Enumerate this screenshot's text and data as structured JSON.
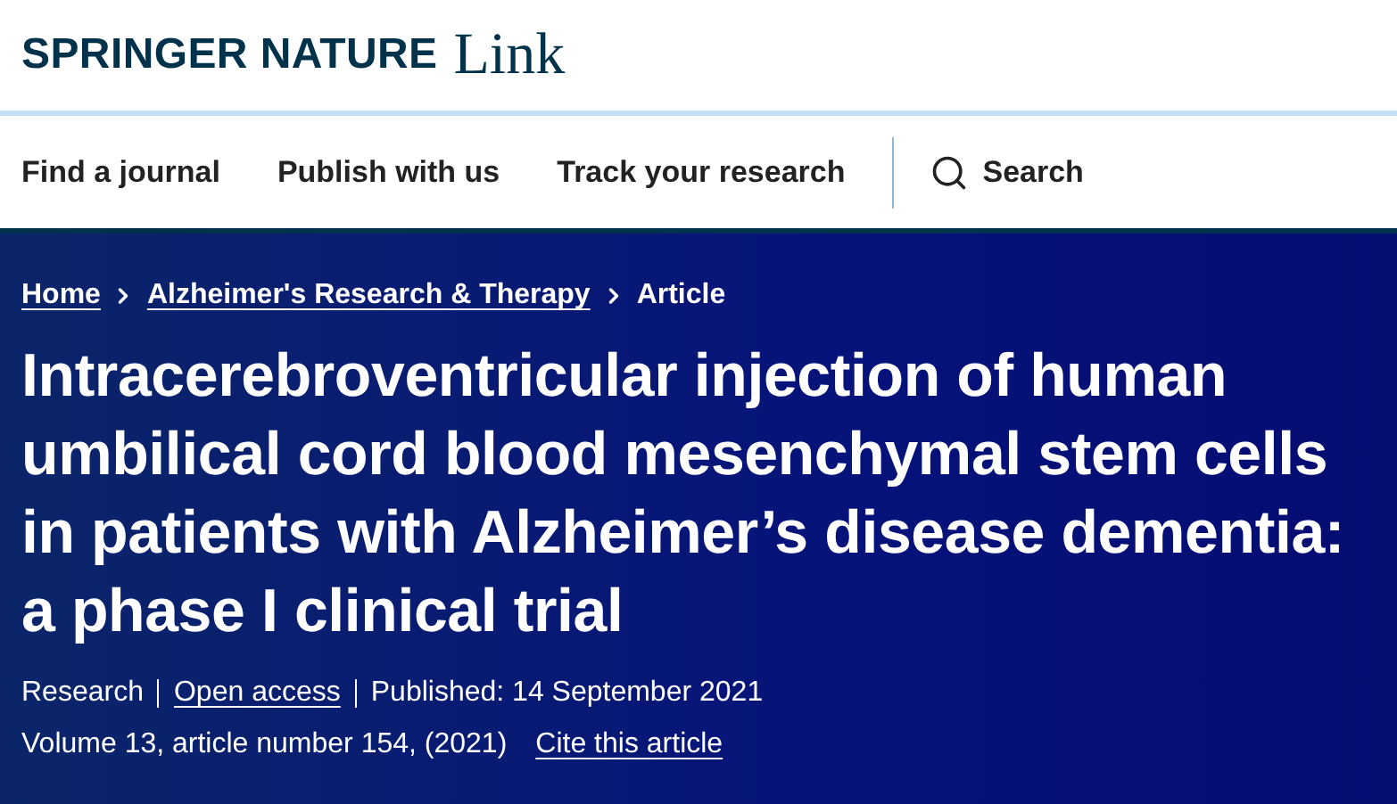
{
  "logo": {
    "brand": "SPRINGER NATURE",
    "product": "Link"
  },
  "nav": [
    {
      "label": "Find a journal"
    },
    {
      "label": "Publish with us"
    },
    {
      "label": "Track your research"
    }
  ],
  "search": {
    "label": "Search"
  },
  "breadcrumbs": [
    {
      "label": "Home",
      "current": false
    },
    {
      "label": "Alzheimer's Research & Therapy",
      "current": false
    },
    {
      "label": "Article",
      "current": true
    }
  ],
  "title": "Intracerebroventricular injection of human umbilical cord blood mesenchymal stem cells in patients with Alzheimer’s disease dementia: a phase I clinical trial",
  "meta": [
    {
      "text": "Research",
      "link": false
    },
    {
      "text": "Open access",
      "link": true
    },
    {
      "text": "Published: 14 September 2021",
      "link": false
    }
  ],
  "citation": {
    "text": "Volume 13, article number 154, (2021)",
    "cite_link": "Cite this article"
  }
}
